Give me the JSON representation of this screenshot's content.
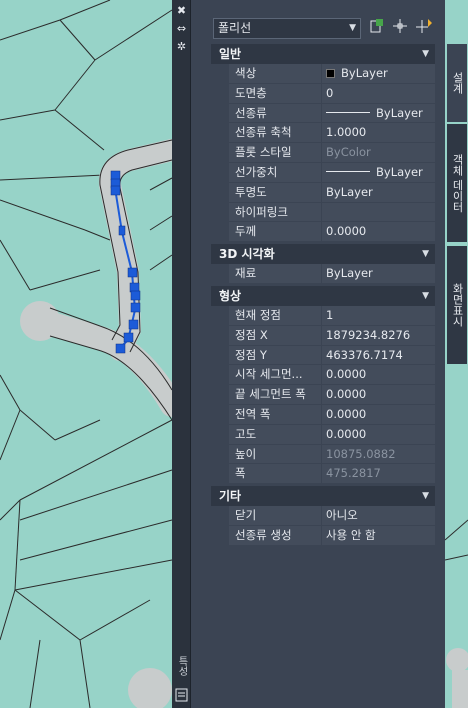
{
  "strip": {
    "close_glyph": "✖",
    "autohide_glyph": "⇔",
    "settings_glyph": "✲",
    "vertical_label": "특성"
  },
  "header": {
    "object_type": "폴리선"
  },
  "sections": [
    {
      "title": "일반",
      "rows": [
        {
          "label": "색상",
          "value": "ByLayer"
        },
        {
          "label": "도면층",
          "value": "0"
        },
        {
          "label": "선종류",
          "value": "ByLayer"
        },
        {
          "label": "선종류 축척",
          "value": "1.0000"
        },
        {
          "label": "플롯 스타일",
          "value": "ByColor"
        },
        {
          "label": "선가중치",
          "value": "ByLayer"
        },
        {
          "label": "투명도",
          "value": "ByLayer"
        },
        {
          "label": "하이퍼링크",
          "value": ""
        },
        {
          "label": "두께",
          "value": "0.0000"
        }
      ]
    },
    {
      "title": "3D 시각화",
      "rows": [
        {
          "label": "재료",
          "value": "ByLayer"
        }
      ]
    },
    {
      "title": "형상",
      "rows": [
        {
          "label": "현재 정점",
          "value": "1"
        },
        {
          "label": "정점 X",
          "value": "1879234.8276"
        },
        {
          "label": "정점 Y",
          "value": "463376.7174"
        },
        {
          "label": "시작 세그먼...",
          "value": "0.0000"
        },
        {
          "label": "끝 세그먼트 폭",
          "value": "0.0000"
        },
        {
          "label": "전역 폭",
          "value": "0.0000"
        },
        {
          "label": "고도",
          "value": "0.0000"
        },
        {
          "label": "높이",
          "value": "10875.0882"
        },
        {
          "label": "폭",
          "value": "475.2817"
        }
      ]
    },
    {
      "title": "기타",
      "rows": [
        {
          "label": "닫기",
          "value": "아니오"
        },
        {
          "label": "선종류 생성",
          "value": "사용 안 함"
        }
      ]
    }
  ],
  "tabs": {
    "design": "설계",
    "object_data": "객체 데이터",
    "display": "화면표시"
  },
  "colors": {
    "map_fill": "#97d3c8",
    "road": "#c8cccc",
    "polyline": "#1c5bd8",
    "panel": "#3b4453"
  }
}
